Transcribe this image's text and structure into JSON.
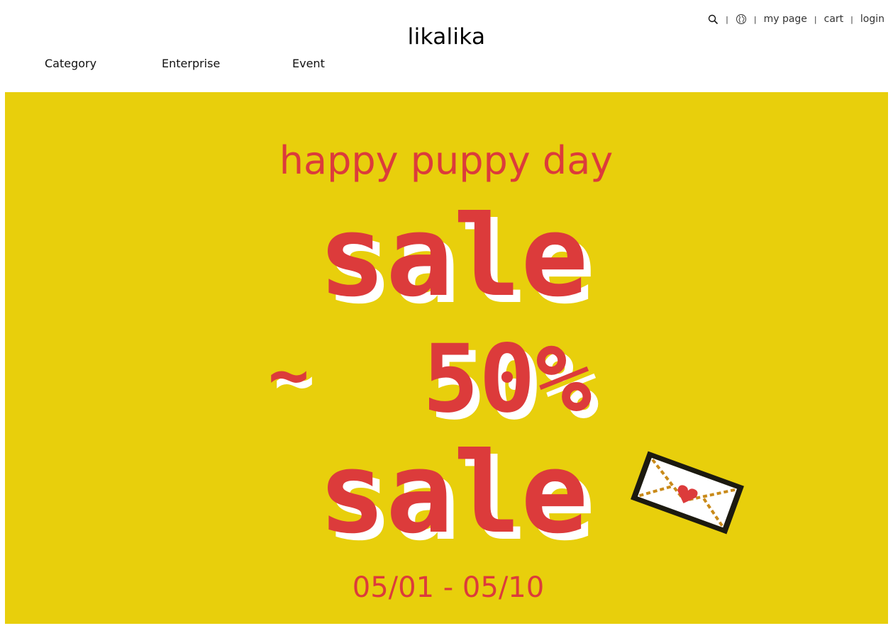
{
  "header": {
    "logo": "likalika",
    "utility": {
      "search_icon": "search-icon",
      "language_icon": "globe-icon",
      "separator": "|",
      "my_page": "my page",
      "cart": "cart",
      "login": "login"
    },
    "nav": [
      {
        "label": "Category"
      },
      {
        "label": "Enterprise"
      },
      {
        "label": "Event"
      }
    ]
  },
  "banner": {
    "headline": "happy puppy day",
    "line1": "sale",
    "line2_prefix": "~",
    "line2": "50%",
    "line3": "sale",
    "dates": "05/01 - 05/10",
    "envelope_icon": "envelope-heart-icon",
    "colors": {
      "background": "#e8cf0c",
      "accent": "#dc3b3b",
      "shadow": "#ffffff"
    }
  }
}
